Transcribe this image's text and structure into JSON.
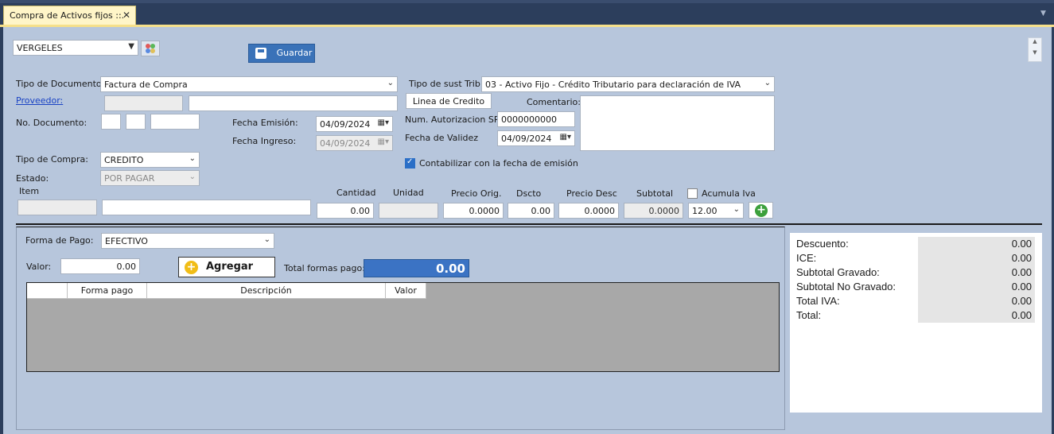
{
  "tab": {
    "title": "Compra de Activos fijos ::.",
    "close": "✕"
  },
  "toolbar": {
    "branch": "VERGELES",
    "save_label": "Guardar"
  },
  "header": {
    "tipo_documento_label": "Tipo de Documento:",
    "tipo_documento_value": "Factura de Compra",
    "tipo_sust_label": "Tipo de sust Trib:",
    "tipo_sust_value": "03 - Activo Fijo - Crédito Tributario para declaración de IVA",
    "proveedor_label": "Proveedor:",
    "linea_credito_label": "Linea de Credito",
    "comentario_label": "Comentario:",
    "no_documento_label": "No. Documento:",
    "fecha_emision_label": "Fecha Emisión:",
    "fecha_emision_value": "04/09/2024",
    "fecha_ingreso_label": "Fecha Ingreso:",
    "fecha_ingreso_value": "04/09/2024",
    "num_autorizacion_label": "Num. Autorizacion SRI",
    "num_autorizacion_value": "0000000000",
    "fecha_validez_label": "Fecha de Validez",
    "fecha_validez_value": "04/09/2024",
    "tipo_compra_label": "Tipo de Compra:",
    "tipo_compra_value": "CREDITO",
    "estado_label": "Estado:",
    "estado_value": "POR PAGAR",
    "contabilizar_label": "Contabilizar con la fecha de emisión"
  },
  "item": {
    "item_label": "Item",
    "cantidad_label": "Cantidad",
    "cantidad_value": "0.00",
    "unidad_label": "Unidad",
    "precio_orig_label": "Precio Orig.",
    "precio_orig_value": "0.0000",
    "dscto_label": "Dscto",
    "dscto_value": "0.00",
    "precio_desc_label": "Precio Desc",
    "precio_desc_value": "0.0000",
    "subtotal_label": "Subtotal",
    "subtotal_value": "0.0000",
    "acumula_iva_label": "Acumula Iva",
    "iva_value": "12.00"
  },
  "payment": {
    "forma_pago_label": "Forma de Pago:",
    "forma_pago_value": "EFECTIVO",
    "valor_label": "Valor:",
    "valor_value": "0.00",
    "agregar_label": "Agregar",
    "total_formas_label": "Total formas pago:",
    "total_formas_value": "0.00",
    "grid_headers": [
      "",
      "Forma pago",
      "Descripción",
      "Valor"
    ]
  },
  "summary": [
    {
      "label": "Descuento:",
      "value": "0.00"
    },
    {
      "label": "ICE:",
      "value": "0.00"
    },
    {
      "label": "Subtotal Gravado:",
      "value": "0.00"
    },
    {
      "label": "Subtotal No Gravado:",
      "value": "0.00"
    },
    {
      "label": "Total IVA:",
      "value": "0.00"
    },
    {
      "label": "Total:",
      "value": "0.00"
    }
  ],
  "colors": {
    "background": "#b7c6dc",
    "accent": "#3b73c4",
    "tab": "#fff5c8"
  }
}
